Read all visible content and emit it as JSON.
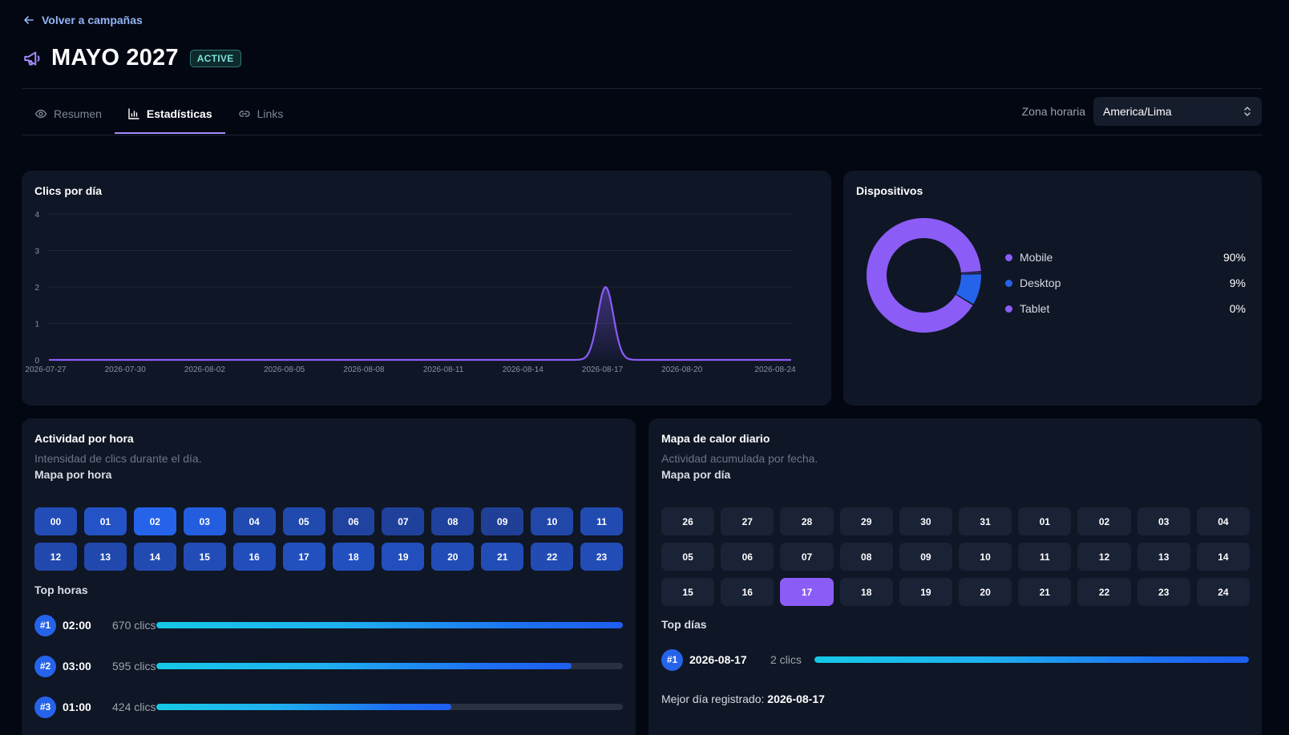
{
  "header": {
    "back_label": "Volver a campañas",
    "title": "MAYO 2027",
    "status": "ACTIVE"
  },
  "tabs": [
    {
      "label": "Resumen",
      "icon": "eye-icon"
    },
    {
      "label": "Estadísticas",
      "icon": "bar-chart-icon",
      "active": true
    },
    {
      "label": "Links",
      "icon": "link-icon"
    }
  ],
  "timezone": {
    "label": "Zona horaria",
    "value": "America/Lima"
  },
  "clicks_chart": {
    "title": "Clics por día",
    "chart_data": {
      "type": "area",
      "title": "Clics por día",
      "xlabel": "",
      "ylabel": "",
      "ylim": [
        0,
        4
      ],
      "yticks": [
        "0",
        "1",
        "2",
        "3",
        "4"
      ],
      "xticks": [
        "2026-07-27",
        "2026-07-30",
        "2026-08-02",
        "2026-08-05",
        "2026-08-08",
        "2026-08-11",
        "2026-08-14",
        "2026-08-17",
        "2026-08-20",
        "2026-08-24"
      ],
      "x": [
        "2026-07-27",
        "2026-07-28",
        "2026-07-29",
        "2026-07-30",
        "2026-07-31",
        "2026-08-01",
        "2026-08-02",
        "2026-08-03",
        "2026-08-04",
        "2026-08-05",
        "2026-08-06",
        "2026-08-07",
        "2026-08-08",
        "2026-08-09",
        "2026-08-10",
        "2026-08-11",
        "2026-08-12",
        "2026-08-13",
        "2026-08-14",
        "2026-08-15",
        "2026-08-16",
        "2026-08-17",
        "2026-08-18",
        "2026-08-19",
        "2026-08-20",
        "2026-08-21",
        "2026-08-22",
        "2026-08-23",
        "2026-08-24"
      ],
      "values": [
        0,
        0,
        0,
        0,
        0,
        0,
        0,
        0,
        0,
        0,
        0,
        0,
        0,
        0,
        0,
        0,
        0,
        0,
        0,
        0,
        0,
        2,
        0,
        0,
        0,
        0,
        0,
        0,
        0
      ],
      "grid": true,
      "colors": {
        "line": "#8b5cf6"
      }
    }
  },
  "devices": {
    "title": "Dispositivos",
    "chart_data": {
      "type": "pie",
      "categories": [
        "Mobile",
        "Desktop",
        "Tablet"
      ],
      "values": [
        90,
        9,
        0.5
      ],
      "labels": [
        "90%",
        "9%",
        "0%"
      ],
      "colors": [
        "#8b5cf6",
        "#2563eb",
        "#8b5cf6"
      ],
      "legend": "right"
    }
  },
  "hourly": {
    "title": "Actividad por hora",
    "subtitle": "Intensidad de clics durante el día.",
    "map_label": "Mapa por hora",
    "hours": [
      {
        "label": "00",
        "intensity": 0.55
      },
      {
        "label": "01",
        "intensity": 0.68
      },
      {
        "label": "02",
        "intensity": 1.0
      },
      {
        "label": "03",
        "intensity": 0.9
      },
      {
        "label": "04",
        "intensity": 0.5
      },
      {
        "label": "05",
        "intensity": 0.48
      },
      {
        "label": "06",
        "intensity": 0.35
      },
      {
        "label": "07",
        "intensity": 0.3
      },
      {
        "label": "08",
        "intensity": 0.33
      },
      {
        "label": "09",
        "intensity": 0.28
      },
      {
        "label": "10",
        "intensity": 0.42
      },
      {
        "label": "11",
        "intensity": 0.5
      },
      {
        "label": "12",
        "intensity": 0.45
      },
      {
        "label": "13",
        "intensity": 0.45
      },
      {
        "label": "14",
        "intensity": 0.5
      },
      {
        "label": "15",
        "intensity": 0.55
      },
      {
        "label": "16",
        "intensity": 0.58
      },
      {
        "label": "17",
        "intensity": 0.62
      },
      {
        "label": "18",
        "intensity": 0.62
      },
      {
        "label": "19",
        "intensity": 0.6
      },
      {
        "label": "20",
        "intensity": 0.55
      },
      {
        "label": "21",
        "intensity": 0.55
      },
      {
        "label": "22",
        "intensity": 0.52
      },
      {
        "label": "23",
        "intensity": 0.55
      }
    ],
    "top_label": "Top horas",
    "top": [
      {
        "rank": "#1",
        "key": "02:00",
        "count": "670 clics",
        "fraction": 1.0
      },
      {
        "rank": "#2",
        "key": "03:00",
        "count": "595 clics",
        "fraction": 0.89
      },
      {
        "rank": "#3",
        "key": "01:00",
        "count": "424 clics",
        "fraction": 0.633
      }
    ]
  },
  "daily": {
    "title": "Mapa de calor diario",
    "subtitle": "Actividad acumulada por fecha.",
    "map_label": "Mapa por día",
    "days": [
      {
        "label": "26"
      },
      {
        "label": "27"
      },
      {
        "label": "28"
      },
      {
        "label": "29"
      },
      {
        "label": "30"
      },
      {
        "label": "31"
      },
      {
        "label": "01"
      },
      {
        "label": "02"
      },
      {
        "label": "03"
      },
      {
        "label": "04"
      },
      {
        "label": "05"
      },
      {
        "label": "06"
      },
      {
        "label": "07"
      },
      {
        "label": "08"
      },
      {
        "label": "09"
      },
      {
        "label": "10"
      },
      {
        "label": "11"
      },
      {
        "label": "12"
      },
      {
        "label": "13"
      },
      {
        "label": "14"
      },
      {
        "label": "15"
      },
      {
        "label": "16"
      },
      {
        "label": "17",
        "hot": true
      },
      {
        "label": "18"
      },
      {
        "label": "19"
      },
      {
        "label": "20"
      },
      {
        "label": "21"
      },
      {
        "label": "22"
      },
      {
        "label": "23"
      },
      {
        "label": "24"
      }
    ],
    "top_label": "Top días",
    "top": [
      {
        "rank": "#1",
        "key": "2026-08-17",
        "count": "2 clics",
        "fraction": 1.0
      }
    ],
    "best_label": "Mejor día registrado:",
    "best_value": "2026-08-17"
  }
}
